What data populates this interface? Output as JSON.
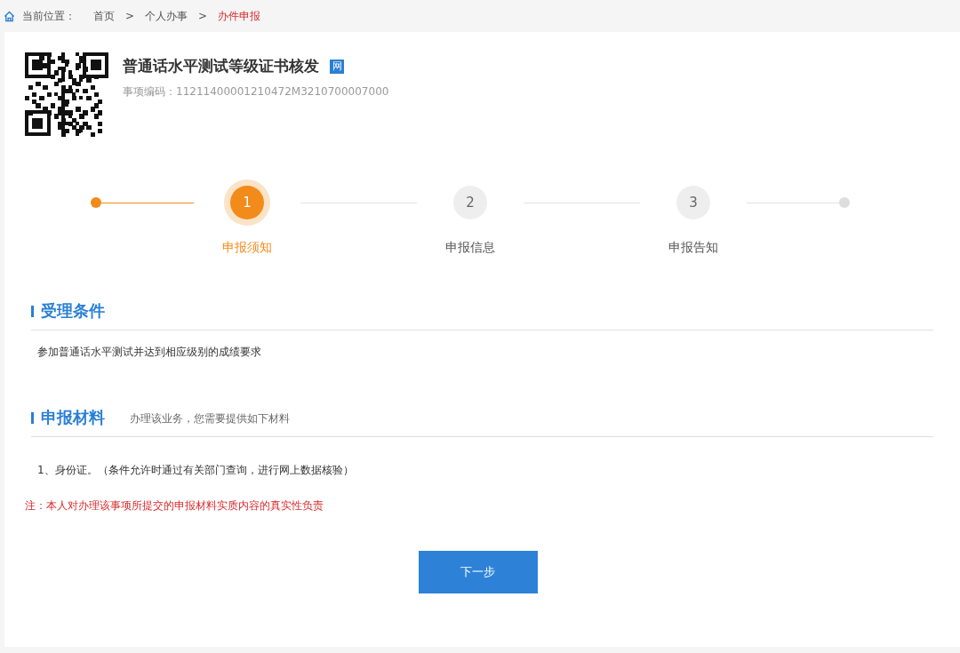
{
  "breadcrumb": {
    "label": "当前位置：",
    "separator": ">",
    "items": [
      {
        "text": "首页",
        "selected": false
      },
      {
        "text": "个人办事",
        "selected": false
      },
      {
        "text": "办件申报",
        "selected": true
      }
    ]
  },
  "service": {
    "title": "普通话水平测试等级证书核发",
    "badge": "网",
    "code": "事项编码：11211400001210472M3210700007000"
  },
  "steps": [
    {
      "number": "1",
      "label": "申报须知",
      "selected": true
    },
    {
      "number": "2",
      "label": "申报信息",
      "selected": false
    },
    {
      "number": "3",
      "label": "申报告知",
      "selected": false
    }
  ],
  "conditions": {
    "heading": "受理条件",
    "text": "参加普通话水平测试并达到相应级别的成绩要求"
  },
  "materials": {
    "heading": "申报材料",
    "hint": "办理该业务，您需要提供如下材料",
    "items": [
      "1、身份证。（条件允许时通过有关部门查询，进行网上数据核验）"
    ],
    "note": "注：本人对办理该事项所提交的申报材料实质内容的真实性负责"
  },
  "next_button": "下一步"
}
